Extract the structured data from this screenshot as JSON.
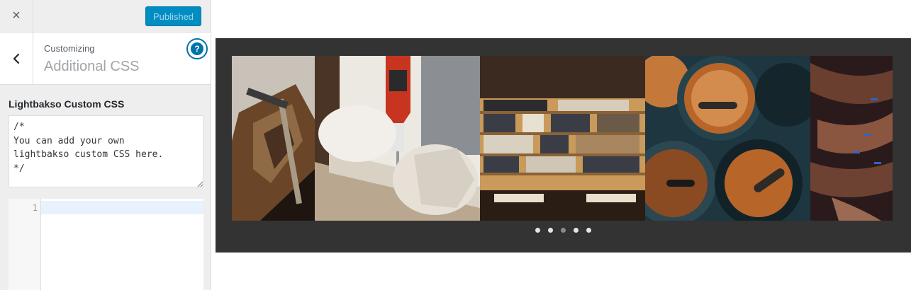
{
  "topbar": {
    "close_icon": "×",
    "publish_label": "Published"
  },
  "section": {
    "breadcrumb": "Customizing",
    "title": "Additional CSS",
    "help_icon": "?"
  },
  "control": {
    "label": "Lightbakso Custom CSS",
    "textarea_value": "/*\nYou can add your own\nlightbakso custom CSS here.\n*/"
  },
  "code_editor": {
    "line_numbers": [
      "1"
    ]
  },
  "slider": {
    "slide_count": 5,
    "active_index": 2
  },
  "colors": {
    "accent": "#0073aa",
    "publish_bg": "#008ec2",
    "sidebar_bg": "#eeeeee",
    "slider_band": "#333333"
  }
}
